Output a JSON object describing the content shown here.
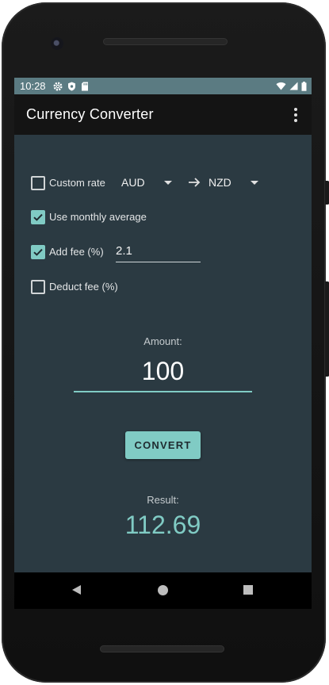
{
  "statusbar": {
    "time": "10:28",
    "left_icons": [
      "gear-icon",
      "shield-icon",
      "sd-card-icon"
    ],
    "right_icons": [
      "wifi-icon",
      "signal-icon",
      "battery-icon"
    ]
  },
  "appbar": {
    "title": "Currency Converter",
    "menu_icon": "more-vert-icon"
  },
  "options": {
    "custom_rate": {
      "label": "Custom rate",
      "checked": false
    },
    "from_currency": "AUD",
    "to_currency": "NZD",
    "use_monthly_average": {
      "label": "Use monthly average",
      "checked": true
    },
    "add_fee": {
      "label": "Add fee (%)",
      "checked": true,
      "value": "2.1"
    },
    "deduct_fee": {
      "label": "Deduct fee (%)",
      "checked": false
    }
  },
  "amount": {
    "label": "Amount:",
    "value": "100"
  },
  "convert_button": {
    "label": "CONVERT"
  },
  "result": {
    "label": "Result:",
    "value": "112.69"
  },
  "colors": {
    "accent": "#80cbc4",
    "background": "#2b3a42",
    "appbar": "#141414",
    "statusbar": "#5b7b82"
  }
}
